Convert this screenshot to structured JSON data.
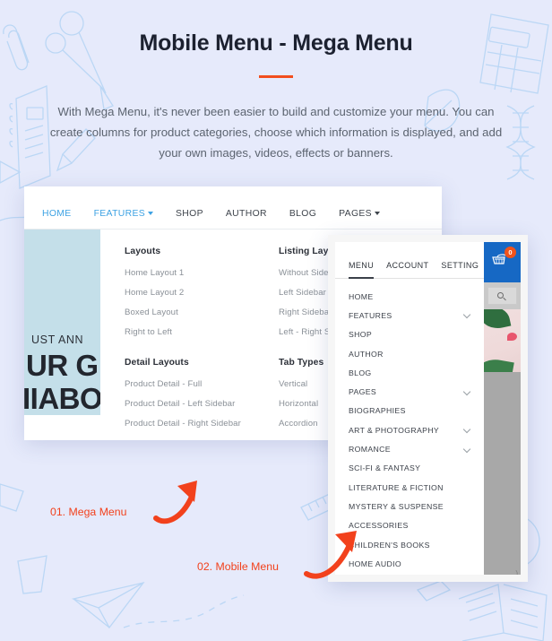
{
  "header": {
    "title": "Mobile Menu - Mega Menu",
    "accent_color": "#f24e1e",
    "description": "With Mega Menu, it's never been easier to build and customize your menu. You can create columns for product categories, choose which information is displayed, and add your own images, videos, effects or banners."
  },
  "desktop": {
    "nav": [
      {
        "label": "HOME",
        "active": true,
        "caret": false
      },
      {
        "label": "FEATURES",
        "active": true,
        "caret": true
      },
      {
        "label": "SHOP",
        "active": false,
        "caret": false
      },
      {
        "label": "AUTHOR",
        "active": false,
        "caret": false
      },
      {
        "label": "BLOG",
        "active": false,
        "caret": false
      },
      {
        "label": "PAGES",
        "active": false,
        "caret": true
      }
    ],
    "hero": {
      "kicker": "UST ANN",
      "line1": "UR G",
      "line2": "IIABOOKCLUB",
      "bg_color": "#c4dfe9",
      "accent_color": "#f0d9a8"
    },
    "mega_menu": {
      "columns": [
        {
          "groups": [
            {
              "heading": "Layouts",
              "links": [
                "Home Layout 1",
                "Home Layout 2",
                "Boxed Layout",
                "Right to Left"
              ]
            },
            {
              "heading": "Detail Layouts",
              "links": [
                "Product Detail - Full",
                "Product Detail - Left Sidebar",
                "Product Detail - Right Sidebar"
              ]
            }
          ]
        },
        {
          "groups": [
            {
              "heading": "Listing Layouts",
              "links": [
                "Without Sidebar",
                "Left Sidebar",
                "Right Sidebar",
                "Left - Right Sidebar"
              ]
            },
            {
              "heading": "Tab Types",
              "links": [
                "Vertical",
                "Horizontal",
                "Accordion"
              ]
            }
          ]
        }
      ]
    }
  },
  "mobile": {
    "topbar": {
      "cart_badge": "0",
      "bar_color": "#1668c4"
    },
    "search_placeholder": "",
    "body_text": ")",
    "tabs": [
      {
        "label": "MENU",
        "active": true
      },
      {
        "label": "ACCOUNT",
        "active": false
      },
      {
        "label": "SETTING",
        "active": false
      }
    ],
    "menu_items": [
      {
        "label": "HOME",
        "chevron": false
      },
      {
        "label": "FEATURES",
        "chevron": true
      },
      {
        "label": "SHOP",
        "chevron": false
      },
      {
        "label": "AUTHOR",
        "chevron": false
      },
      {
        "label": "BLOG",
        "chevron": false
      },
      {
        "label": "PAGES",
        "chevron": true
      },
      {
        "label": "BIOGRAPHIES",
        "chevron": false
      },
      {
        "label": "ART & PHOTOGRAPHY",
        "chevron": true
      },
      {
        "label": "ROMANCE",
        "chevron": true
      },
      {
        "label": "SCI-FI & FANTASY",
        "chevron": false
      },
      {
        "label": "LITERATURE & FICTION",
        "chevron": false
      },
      {
        "label": "MYSTERY & SUSPENSE",
        "chevron": false
      },
      {
        "label": "ACCESSORIES",
        "chevron": false
      },
      {
        "label": "CHILDREN'S BOOKS",
        "chevron": false
      },
      {
        "label": "HOME AUDIO",
        "chevron": false
      }
    ]
  },
  "annotations": {
    "color": "#f2411c",
    "items": [
      {
        "label": "01. Mega Menu"
      },
      {
        "label": "02. Mobile Menu"
      }
    ]
  }
}
